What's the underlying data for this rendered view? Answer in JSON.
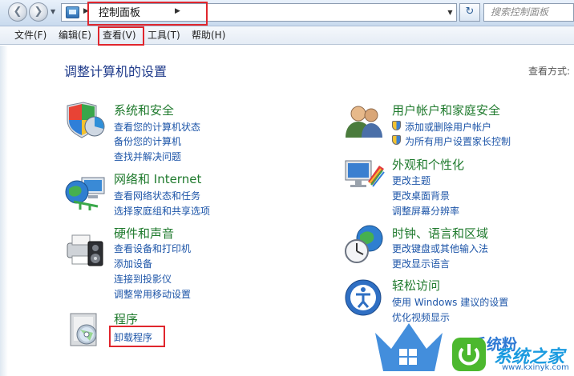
{
  "nav": {
    "address_crumb": "控制面板",
    "search_placeholder": "搜索控制面板"
  },
  "menu": {
    "items": [
      "文件(F)",
      "编辑(E)",
      "查看(V)",
      "工具(T)",
      "帮助(H)"
    ]
  },
  "page": {
    "title": "调整计算机的设置",
    "view_by": "查看方式:"
  },
  "categories": {
    "system_security": {
      "title": "系统和安全",
      "links": [
        "查看您的计算机状态",
        "备份您的计算机",
        "查找并解决问题"
      ]
    },
    "network": {
      "title": "网络和 Internet",
      "links": [
        "查看网络状态和任务",
        "选择家庭组和共享选项"
      ]
    },
    "hardware": {
      "title": "硬件和声音",
      "links": [
        "查看设备和打印机",
        "添加设备",
        "连接到投影仪",
        "调整常用移动设置"
      ]
    },
    "programs": {
      "title": "程序",
      "links": [
        "卸载程序"
      ]
    },
    "user_accounts": {
      "title": "用户帐户和家庭安全",
      "links": [
        "添加或删除用户帐户",
        "为所有用户设置家长控制"
      ]
    },
    "appearance": {
      "title": "外观和个性化",
      "links": [
        "更改主题",
        "更改桌面背景",
        "调整屏幕分辨率"
      ]
    },
    "clock": {
      "title": "时钟、语言和区域",
      "links": [
        "更改键盘或其他输入法",
        "更改显示语言"
      ]
    },
    "ease": {
      "title": "轻松访问",
      "links": [
        "使用 Windows 建议的设置",
        "优化视频显示"
      ]
    }
  },
  "watermark": {
    "text1": "系统粉",
    "text2": "系统之家",
    "url": "www.kxinyk.com"
  }
}
